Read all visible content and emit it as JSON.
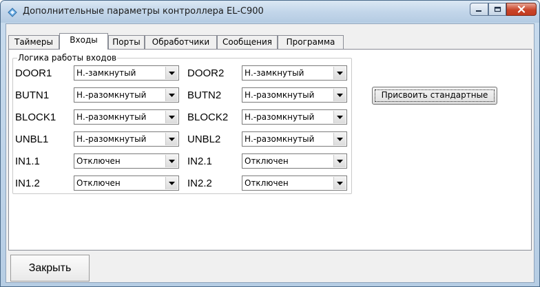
{
  "window": {
    "title": "Дополнительные параметры контроллера EL-C900"
  },
  "tabs": [
    {
      "label": "Таймеры"
    },
    {
      "label": "Входы"
    },
    {
      "label": "Порты"
    },
    {
      "label": "Обработчики"
    },
    {
      "label": "Сообщения"
    },
    {
      "label": "Программа"
    }
  ],
  "active_tab": "Входы",
  "group": {
    "title": "Логика работы входов"
  },
  "inputs": [
    {
      "left_label": "DOOR1",
      "left_value": "Н.-замкнутый",
      "right_label": "DOOR2",
      "right_value": "Н.-замкнутый"
    },
    {
      "left_label": "BUTN1",
      "left_value": "Н.-разомкнутый",
      "right_label": "BUTN2",
      "right_value": "Н.-разомкнутый"
    },
    {
      "left_label": "BLOCK1",
      "left_value": "Н.-разомкнутый",
      "right_label": "BLOCK2",
      "right_value": "Н.-разомкнутый"
    },
    {
      "left_label": "UNBL1",
      "left_value": "Н.-разомкнутый",
      "right_label": "UNBL2",
      "right_value": "Н.-разомкнутый"
    },
    {
      "left_label": "IN1.1",
      "left_value": "Отключен",
      "right_label": "IN2.1",
      "right_value": "Отключен"
    },
    {
      "left_label": "IN1.2",
      "left_value": "Отключен",
      "right_label": "IN2.2",
      "right_value": "Отключен"
    }
  ],
  "buttons": {
    "assign_default": "Присвоить стандартные",
    "close": "Закрыть"
  },
  "colors": {
    "titlebar": "#c3d6ea",
    "close_button": "#c9452a",
    "dialog_background": "#f0f0f0"
  }
}
